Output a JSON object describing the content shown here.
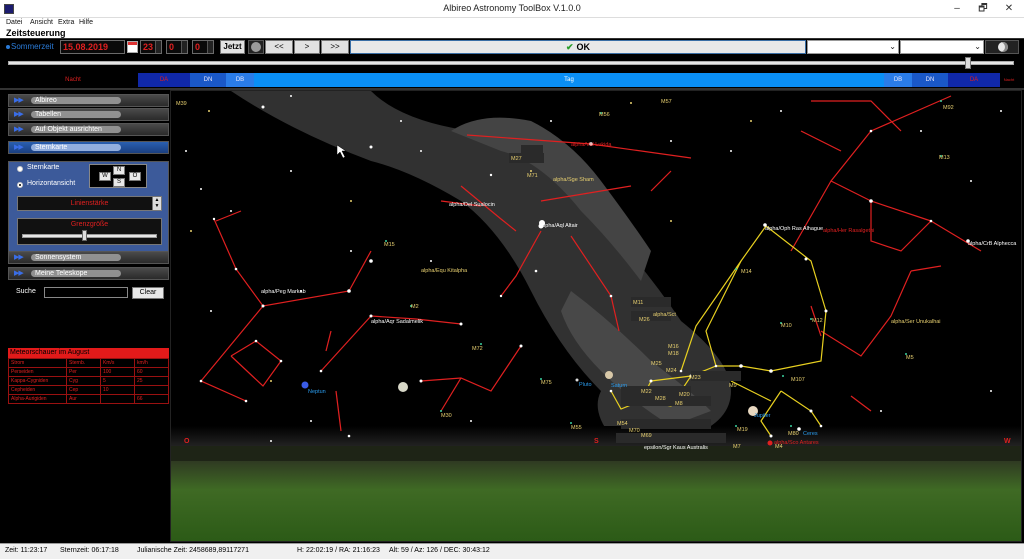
{
  "window": {
    "title": "Albireo Astronomy ToolBox V.1.0.0",
    "minimize": "–",
    "maximize": "🗗",
    "close": "✕"
  },
  "menu": [
    "Datei",
    "Ansicht",
    "Extra",
    "Hilfe"
  ],
  "section_title": "Zeitsteuerung",
  "time": {
    "sommerzeit_label": "Sommerzeit",
    "date": "15.08.2019",
    "hour": "23",
    "minute": "0",
    "second": "0",
    "now_label": "Jetzt",
    "back_fast": "<<",
    "forward": ">",
    "forward_fast": ">>",
    "ok_label": "OK",
    "ok_icon": "✔",
    "select1": "",
    "select2": "",
    "dropdown_icon": "⌄"
  },
  "day_strip": [
    {
      "label": "Nacht",
      "type": "nacht"
    },
    {
      "label": "DA",
      "type": "da"
    },
    {
      "label": "DN",
      "type": "dn"
    },
    {
      "label": "DB",
      "type": "db"
    },
    {
      "label": "Tag",
      "type": "tag"
    },
    {
      "label": "DB",
      "type": "db"
    },
    {
      "label": "DN",
      "type": "dn"
    },
    {
      "label": "DA",
      "type": "da"
    },
    {
      "label": "Nacht",
      "type": "nacht"
    }
  ],
  "sidebar": {
    "items": [
      {
        "label": "Albireo",
        "active": false
      },
      {
        "label": "Tabellen",
        "active": false
      },
      {
        "label": "Auf Objekt ausrichten",
        "active": false
      },
      {
        "label": "Sternkarte",
        "active": true
      },
      {
        "label": "Sonnensystem",
        "active": false
      },
      {
        "label": "Meine Teleskope",
        "active": false
      }
    ],
    "arrows": "▶▶",
    "sternkarte": {
      "option_sternkarte": "Sternkarte",
      "option_horizont": "Horizontansicht",
      "selected": "Horizontansicht",
      "compass": {
        "n": "N",
        "w": "W",
        "s": "S",
        "o": "O"
      },
      "linien_label": "Linienstärke",
      "grenz_label": "Grenzgröße",
      "spin_up": "▲",
      "spin_down": "▼"
    },
    "search_label": "Suche",
    "search_value": "",
    "clear_label": "Clear",
    "meteor": {
      "title": "Meteorschauer im August",
      "headers": [
        "Strom",
        "Sternb.",
        "Km/s",
        "km/h"
      ],
      "rows": [
        [
          "Perseiden",
          "Per",
          "100",
          "60"
        ],
        [
          "Kappa-Cygniden",
          "Cyg",
          "5",
          "25"
        ],
        [
          "Cepheiden",
          "Cep",
          "10",
          ""
        ],
        [
          "Alpha-Aurigiden",
          "Aur",
          "",
          "66"
        ]
      ]
    }
  },
  "sky": {
    "directions": {
      "east": "O",
      "south": "S",
      "west": "W"
    },
    "labels": [
      {
        "text": "M39",
        "c": "#e8d070"
      },
      {
        "text": "M57",
        "c": "#e8d070"
      },
      {
        "text": "M92",
        "c": "#e8d070"
      },
      {
        "text": "M56",
        "c": "#e8d070"
      },
      {
        "text": "M13",
        "c": "#e8d070"
      },
      {
        "text": "M27",
        "c": "#e8d070"
      },
      {
        "text": "M71",
        "c": "#e8d070"
      },
      {
        "text": "alpha/Vul Lukida",
        "c": "#e02020"
      },
      {
        "text": "alpha/Sge Sham",
        "c": "#e8d070"
      },
      {
        "text": "alpha/Del Sualocin",
        "c": "#ffffff"
      },
      {
        "text": "alpha/Aql Altair",
        "c": "#ffffff"
      },
      {
        "text": "alpha/Oph Ras Alhague",
        "c": "#ffffff"
      },
      {
        "text": "alpha/Her Rasalgethi",
        "c": "#e02020"
      },
      {
        "text": "alpha/CrB Alphecca",
        "c": "#ffffff"
      },
      {
        "text": "M15",
        "c": "#e8d070"
      },
      {
        "text": "alpha/Equ Kitalpha",
        "c": "#e8d070"
      },
      {
        "text": "M14",
        "c": "#e8d070"
      },
      {
        "text": "alpha/Peg Markab",
        "c": "#ffffff"
      },
      {
        "text": "M2",
        "c": "#e8d070"
      },
      {
        "text": "alpha/Aqr Sadalmelik",
        "c": "#ffffff"
      },
      {
        "text": "M11",
        "c": "#e8d070"
      },
      {
        "text": "M26",
        "c": "#e8d070"
      },
      {
        "text": "alpha/Sct",
        "c": "#e8d070"
      },
      {
        "text": "M10",
        "c": "#e8d070"
      },
      {
        "text": "M12",
        "c": "#e8d070"
      },
      {
        "text": "alpha/Ser Unukalhai",
        "c": "#e8d070"
      },
      {
        "text": "M72",
        "c": "#e8d070"
      },
      {
        "text": "M16",
        "c": "#e8d070"
      },
      {
        "text": "M18",
        "c": "#e8d070"
      },
      {
        "text": "M25",
        "c": "#e8d070"
      },
      {
        "text": "M24",
        "c": "#e8d070"
      },
      {
        "text": "M5",
        "c": "#e8d070"
      },
      {
        "text": "M23",
        "c": "#e8d070"
      },
      {
        "text": "M107",
        "c": "#e8d070"
      },
      {
        "text": "Neptun",
        "c": "#2a9df0"
      },
      {
        "text": "M75",
        "c": "#e8d070"
      },
      {
        "text": "Pluto",
        "c": "#2a9df0"
      },
      {
        "text": "Saturn",
        "c": "#2a9df0"
      },
      {
        "text": "M22",
        "c": "#e8d070"
      },
      {
        "text": "M28",
        "c": "#e8d070"
      },
      {
        "text": "M20",
        "c": "#e8d070"
      },
      {
        "text": "M8",
        "c": "#e8d070"
      },
      {
        "text": "M9",
        "c": "#e8d070"
      },
      {
        "text": "M30",
        "c": "#e8d070"
      },
      {
        "text": "Jupiter",
        "c": "#2a9df0"
      },
      {
        "text": "M55",
        "c": "#e8d070"
      },
      {
        "text": "M54",
        "c": "#e8d070"
      },
      {
        "text": "M70",
        "c": "#e8d070"
      },
      {
        "text": "M69",
        "c": "#e8d070"
      },
      {
        "text": "M19",
        "c": "#e8d070"
      },
      {
        "text": "M80",
        "c": "#e8d070"
      },
      {
        "text": "Ceres",
        "c": "#2a9df0"
      },
      {
        "text": "alpha/Sco Antares",
        "c": "#e02020"
      },
      {
        "text": "epsilon/Sgr Kaus Australis",
        "c": "#ffffff"
      },
      {
        "text": "M7",
        "c": "#e8d070"
      },
      {
        "text": "M4",
        "c": "#e8d070"
      }
    ]
  },
  "status": {
    "zeit": "Zeit: 11:23:17",
    "sternzeit": "Sternzeit: 06:17:18",
    "julian": "Julianische Zeit: 2458689,89117271",
    "hra": "H: 22:02:19 / RA: 21:16:23",
    "altaz": "Alt: 59 / Az: 126 / DEC: 30:43:12"
  }
}
